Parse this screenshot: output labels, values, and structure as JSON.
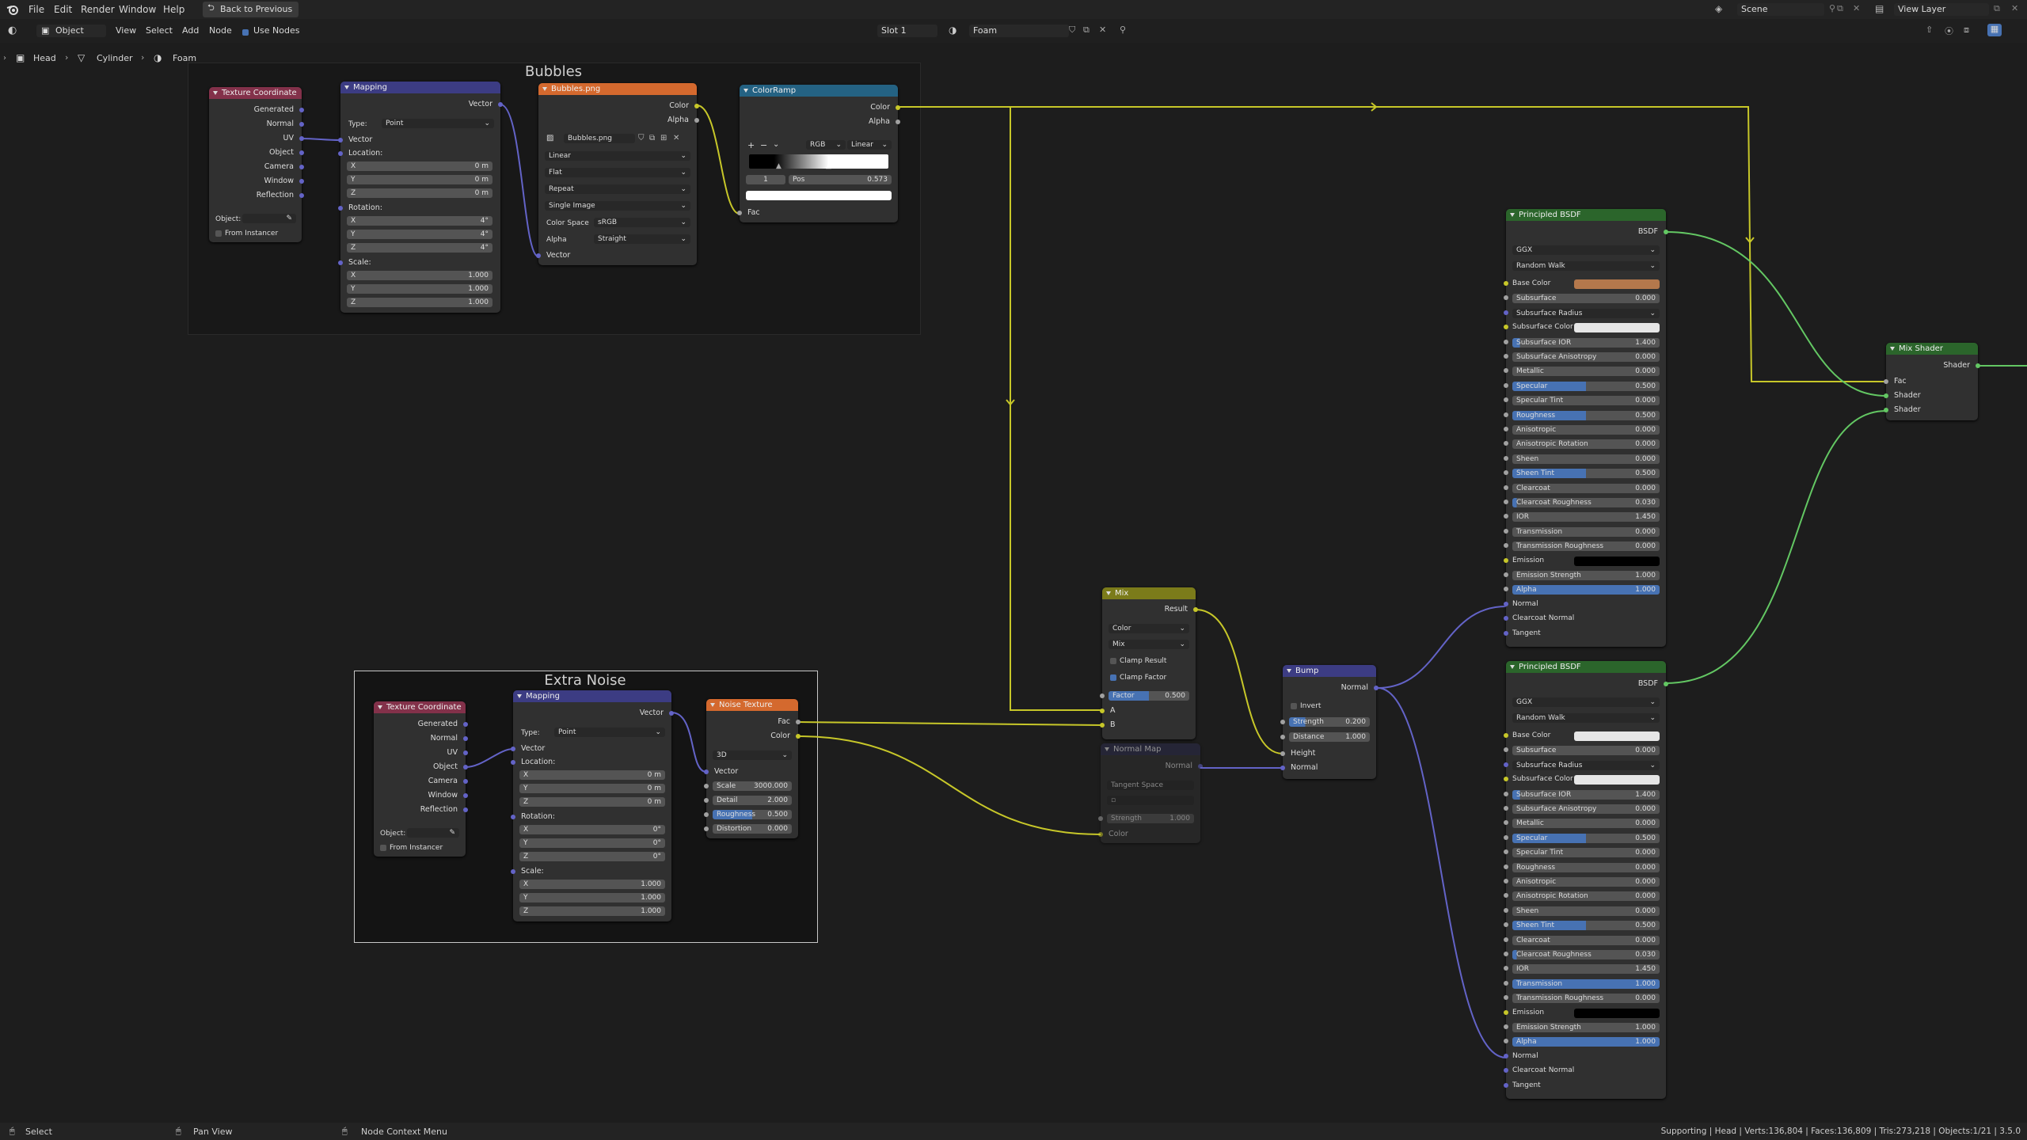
{
  "topbar": {
    "menus": [
      "File",
      "Edit",
      "Render",
      "Window",
      "Help"
    ],
    "back_button": "Back to Previous",
    "scene": "Scene",
    "view_layer": "View Layer"
  },
  "header": {
    "object_mode": "Object",
    "menus": [
      "View",
      "Select",
      "Add",
      "Node"
    ],
    "use_nodes": "Use Nodes",
    "slot": "Slot 1",
    "material": "Foam"
  },
  "breadcrumb": {
    "items": [
      "Head",
      "Cylinder",
      "Foam"
    ]
  },
  "frames": {
    "bubbles": "Bubbles",
    "extra_noise": "Extra Noise"
  },
  "nodes": {
    "texcoord1": {
      "title": "Texture Coordinate",
      "outputs": [
        "Generated",
        "Normal",
        "UV",
        "Object",
        "Camera",
        "Window",
        "Reflection"
      ],
      "object_label": "Object:",
      "from_instancer": "From Instancer"
    },
    "mapping1": {
      "title": "Mapping",
      "output": "Vector",
      "type_label": "Type:",
      "type_value": "Point",
      "vector": "Vector",
      "location": "Location:",
      "loc": [
        {
          "a": "X",
          "v": "0 m"
        },
        {
          "a": "Y",
          "v": "0 m"
        },
        {
          "a": "Z",
          "v": "0 m"
        }
      ],
      "rotation": "Rotation:",
      "rot": [
        {
          "a": "X",
          "v": "4°"
        },
        {
          "a": "Y",
          "v": "4°"
        },
        {
          "a": "Z",
          "v": "4°"
        }
      ],
      "scale": "Scale:",
      "scl": [
        {
          "a": "X",
          "v": "1.000"
        },
        {
          "a": "Y",
          "v": "1.000"
        },
        {
          "a": "Z",
          "v": "1.000"
        }
      ]
    },
    "image": {
      "title": "Bubbles.png",
      "outputs": [
        "Color",
        "Alpha"
      ],
      "image_name": "Bubbles.png",
      "interp": "Linear",
      "proj": "Flat",
      "ext": "Repeat",
      "source": "Single Image",
      "cs_label": "Color Space",
      "cs_value": "sRGB",
      "alpha_label": "Alpha",
      "alpha_value": "Straight",
      "vector": "Vector"
    },
    "ramp": {
      "title": "ColorRamp",
      "outputs": [
        "Color",
        "Alpha"
      ],
      "mode": "RGB",
      "interp": "Linear",
      "index": "1",
      "pos_label": "Pos",
      "pos_value": "0.573",
      "fac": "Fac"
    },
    "pbsdf1": {
      "title": "Principled BSDF",
      "output": "BSDF",
      "dist": "GGX",
      "sss": "Random Walk",
      "rows": [
        {
          "l": "Base Color",
          "t": "color",
          "c": "#b4784c"
        },
        {
          "l": "Subsurface",
          "v": "0.000",
          "t": "num",
          "f": 0
        },
        {
          "l": "Subsurface Radius",
          "t": "dd"
        },
        {
          "l": "Subsurface Color",
          "t": "color",
          "c": "#e6e6e6"
        },
        {
          "l": "Subsurface IOR",
          "v": "1.400",
          "t": "num",
          "f": 0.05
        },
        {
          "l": "Subsurface Anisotropy",
          "v": "0.000",
          "t": "num",
          "f": 0
        },
        {
          "l": "Metallic",
          "v": "0.000",
          "t": "num",
          "f": 0
        },
        {
          "l": "Specular",
          "v": "0.500",
          "t": "num",
          "f": 0.5
        },
        {
          "l": "Specular Tint",
          "v": "0.000",
          "t": "num",
          "f": 0
        },
        {
          "l": "Roughness",
          "v": "0.500",
          "t": "num",
          "f": 0.5
        },
        {
          "l": "Anisotropic",
          "v": "0.000",
          "t": "num",
          "f": 0
        },
        {
          "l": "Anisotropic Rotation",
          "v": "0.000",
          "t": "num",
          "f": 0
        },
        {
          "l": "Sheen",
          "v": "0.000",
          "t": "num",
          "f": 0
        },
        {
          "l": "Sheen Tint",
          "v": "0.500",
          "t": "num",
          "f": 0.5
        },
        {
          "l": "Clearcoat",
          "v": "0.000",
          "t": "num",
          "f": 0
        },
        {
          "l": "Clearcoat Roughness",
          "v": "0.030",
          "t": "num",
          "f": 0.03
        },
        {
          "l": "IOR",
          "v": "1.450",
          "t": "num",
          "f": 0
        },
        {
          "l": "Transmission",
          "v": "0.000",
          "t": "num",
          "f": 0
        },
        {
          "l": "Transmission Roughness",
          "v": "0.000",
          "t": "num",
          "f": 0
        },
        {
          "l": "Emission",
          "t": "color",
          "c": "#000000"
        },
        {
          "l": "Emission Strength",
          "v": "1.000",
          "t": "num",
          "f": 0
        },
        {
          "l": "Alpha",
          "v": "1.000",
          "t": "num",
          "f": 1
        },
        {
          "l": "Normal",
          "t": "plain"
        },
        {
          "l": "Clearcoat Normal",
          "t": "plain"
        },
        {
          "l": "Tangent",
          "t": "plain"
        }
      ]
    },
    "pbsdf2": {
      "title": "Principled BSDF",
      "output": "BSDF",
      "dist": "GGX",
      "sss": "Random Walk",
      "rows": [
        {
          "l": "Base Color",
          "t": "color",
          "c": "#e6e6e6"
        },
        {
          "l": "Subsurface",
          "v": "0.000",
          "t": "num",
          "f": 0
        },
        {
          "l": "Subsurface Radius",
          "t": "dd"
        },
        {
          "l": "Subsurface Color",
          "t": "color",
          "c": "#e6e6e6"
        },
        {
          "l": "Subsurface IOR",
          "v": "1.400",
          "t": "num",
          "f": 0.05
        },
        {
          "l": "Subsurface Anisotropy",
          "v": "0.000",
          "t": "num",
          "f": 0
        },
        {
          "l": "Metallic",
          "v": "0.000",
          "t": "num",
          "f": 0
        },
        {
          "l": "Specular",
          "v": "0.500",
          "t": "num",
          "f": 0.5
        },
        {
          "l": "Specular Tint",
          "v": "0.000",
          "t": "num",
          "f": 0
        },
        {
          "l": "Roughness",
          "v": "0.000",
          "t": "num",
          "f": 0
        },
        {
          "l": "Anisotropic",
          "v": "0.000",
          "t": "num",
          "f": 0
        },
        {
          "l": "Anisotropic Rotation",
          "v": "0.000",
          "t": "num",
          "f": 0
        },
        {
          "l": "Sheen",
          "v": "0.000",
          "t": "num",
          "f": 0
        },
        {
          "l": "Sheen Tint",
          "v": "0.500",
          "t": "num",
          "f": 0.5
        },
        {
          "l": "Clearcoat",
          "v": "0.000",
          "t": "num",
          "f": 0
        },
        {
          "l": "Clearcoat Roughness",
          "v": "0.030",
          "t": "num",
          "f": 0.03
        },
        {
          "l": "IOR",
          "v": "1.450",
          "t": "num",
          "f": 0
        },
        {
          "l": "Transmission",
          "v": "1.000",
          "t": "num",
          "f": 1
        },
        {
          "l": "Transmission Roughness",
          "v": "0.000",
          "t": "num",
          "f": 0
        },
        {
          "l": "Emission",
          "t": "color",
          "c": "#000000"
        },
        {
          "l": "Emission Strength",
          "v": "1.000",
          "t": "num",
          "f": 0
        },
        {
          "l": "Alpha",
          "v": "1.000",
          "t": "num",
          "f": 1
        },
        {
          "l": "Normal",
          "t": "plain"
        },
        {
          "l": "Clearcoat Normal",
          "t": "plain"
        },
        {
          "l": "Tangent",
          "t": "plain"
        }
      ]
    },
    "mixshader": {
      "title": "Mix Shader",
      "output": "Shader",
      "inputs": [
        "Fac",
        "Shader",
        "Shader"
      ]
    },
    "mix": {
      "title": "Mix",
      "output": "Result",
      "dtype": "Color",
      "blend": "Mix",
      "clamp_result": "Clamp Result",
      "clamp_factor": "Clamp Factor",
      "factor_label": "Factor",
      "factor_value": "0.500",
      "a": "A",
      "b": "B"
    },
    "normalmap": {
      "title": "Normal Map",
      "output": "Normal",
      "space": "Tangent Space",
      "strength_label": "Strength",
      "strength_value": "1.000",
      "color": "Color"
    },
    "bump": {
      "title": "Bump",
      "output": "Normal",
      "invert": "Invert",
      "strength_label": "Strength",
      "strength_value": "0.200",
      "distance_label": "Distance",
      "distance_value": "1.000",
      "height": "Height",
      "normal": "Normal"
    },
    "texcoord2": {
      "title": "Texture Coordinate",
      "outputs": [
        "Generated",
        "Normal",
        "UV",
        "Object",
        "Camera",
        "Window",
        "Reflection"
      ],
      "object_label": "Object:",
      "from_instancer": "From Instancer"
    },
    "mapping2": {
      "title": "Mapping",
      "output": "Vector",
      "type_label": "Type:",
      "type_value": "Point",
      "vector": "Vector",
      "location": "Location:",
      "loc": [
        {
          "a": "X",
          "v": "0 m"
        },
        {
          "a": "Y",
          "v": "0 m"
        },
        {
          "a": "Z",
          "v": "0 m"
        }
      ],
      "rotation": "Rotation:",
      "rot": [
        {
          "a": "X",
          "v": "0°"
        },
        {
          "a": "Y",
          "v": "0°"
        },
        {
          "a": "Z",
          "v": "0°"
        }
      ],
      "scale": "Scale:",
      "scl": [
        {
          "a": "X",
          "v": "1.000"
        },
        {
          "a": "Y",
          "v": "1.000"
        },
        {
          "a": "Z",
          "v": "1.000"
        }
      ]
    },
    "noise": {
      "title": "Noise Texture",
      "outputs": [
        "Fac",
        "Color"
      ],
      "dim": "3D",
      "vector": "Vector",
      "fields": [
        {
          "l": "Scale",
          "v": "3000.000",
          "f": 0
        },
        {
          "l": "Detail",
          "v": "2.000",
          "f": 0
        },
        {
          "l": "Roughness",
          "v": "0.500",
          "f": 0.5
        },
        {
          "l": "Distortion",
          "v": "0.000",
          "f": 0
        }
      ]
    }
  },
  "status": {
    "select": "Select",
    "pan": "Pan View",
    "context": "Node Context Menu",
    "info": "Supporting | Head | Verts:136,804 | Faces:136,809 | Tris:273,218 | Objects:1/21 | 3.5.0"
  },
  "colors": {
    "color_socket": "#c7c729",
    "vector_socket": "#6363c7",
    "shader_socket": "#63c763",
    "float_socket": "#a1a1a1",
    "link_yellow": "#c7c729",
    "link_green": "#63c763",
    "link_blue": "#6363c7",
    "hdr_input": "#83314a",
    "hdr_vector": "#3c3c83",
    "hdr_texture": "#d4692e",
    "hdr_converter": "#246283",
    "hdr_shader": "#2b652b",
    "hdr_color": "#7b7b1a"
  },
  "icons": [
    "blender-logo-icon",
    "editor-type-icon",
    "object-mode-icon",
    "material-icon",
    "scene-icon",
    "view-layer-icon",
    "mesh-icon",
    "mouse-icon"
  ]
}
